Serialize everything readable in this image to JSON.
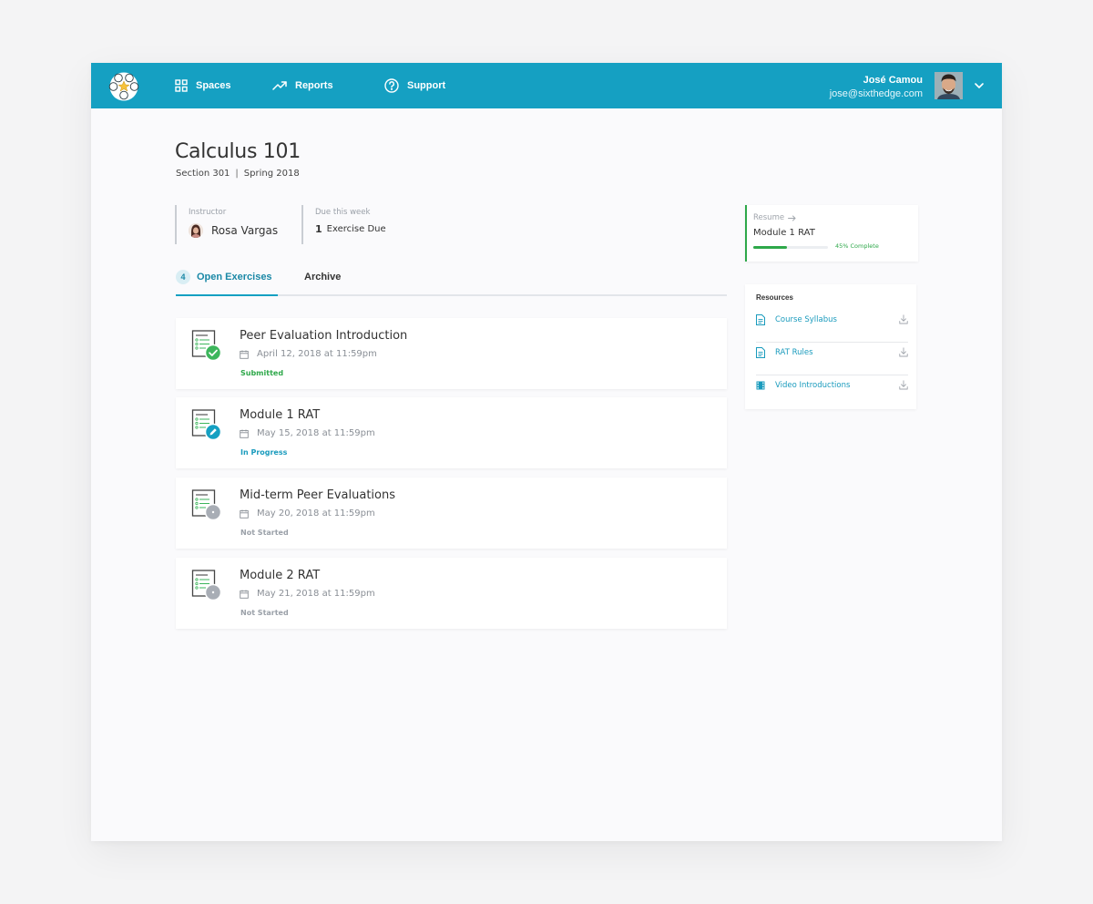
{
  "nav": {
    "items": [
      {
        "label": "Spaces",
        "icon": "grid-icon"
      },
      {
        "label": "Reports",
        "icon": "trend-up-icon"
      },
      {
        "label": "Support",
        "icon": "help-circle-icon"
      }
    ],
    "user": {
      "name": "José Camou",
      "email": "jose@sixthedge.com"
    }
  },
  "course": {
    "title": "Calculus 101",
    "section": "Section 301",
    "term": "Spring 2018"
  },
  "meta": {
    "instructor_label": "Instructor",
    "instructor_name": "Rosa Vargas",
    "due_label": "Due this week",
    "due_count": "1",
    "due_text": "Exercise Due"
  },
  "tabs": {
    "open_count": "4",
    "open_label": "Open Exercises",
    "archive_label": "Archive"
  },
  "exercises": [
    {
      "title": "Peer Evaluation Introduction",
      "date": "April 12, 2018 at 11:59pm",
      "status": "Submitted",
      "status_color": "#2ea84a",
      "badge": "check-badge-icon",
      "badge_color": "#3db65c"
    },
    {
      "title": "Module 1 RAT",
      "date": "May 15, 2018 at 11:59pm",
      "status": "In Progress",
      "status_color": "#1a9bbd",
      "badge": "pencil-badge-icon",
      "badge_color": "#15a0c2"
    },
    {
      "title": "Mid-term Peer Evaluations",
      "date": "May 20, 2018 at 11:59pm",
      "status": "Not Started",
      "status_color": "#9aa0a8",
      "badge": "dot-badge-icon",
      "badge_color": "#a8adb5"
    },
    {
      "title": "Module 2 RAT",
      "date": "May 21, 2018 at 11:59pm",
      "status": "Not Started",
      "status_color": "#9aa0a8",
      "badge": "dot-badge-icon",
      "badge_color": "#a8adb5"
    }
  ],
  "resume": {
    "label": "Resume",
    "title": "Module 1 RAT",
    "progress_percent": 45,
    "progress_text": "45% Complete"
  },
  "resources": {
    "title": "Resources",
    "items": [
      {
        "label": "Course Syllabus",
        "icon": "document-icon"
      },
      {
        "label": "RAT Rules",
        "icon": "document-icon"
      },
      {
        "label": "Video Introductions",
        "icon": "film-icon"
      }
    ]
  },
  "colors": {
    "brand": "#15a0c2",
    "success": "#2ea84a",
    "muted": "#9aa0a8"
  }
}
